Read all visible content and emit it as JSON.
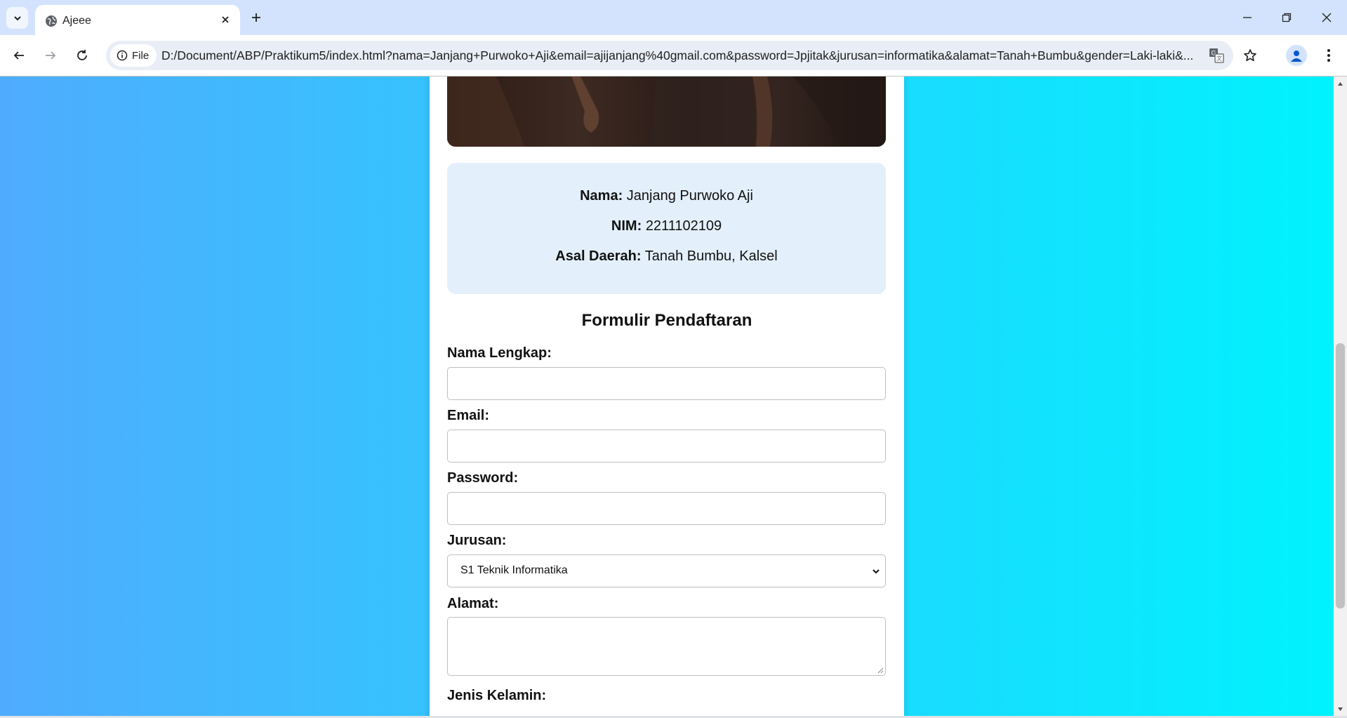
{
  "browser": {
    "tab_title": "Ajeee",
    "file_chip": "File",
    "url": "D:/Document/ABP/Praktikum5/index.html?nama=Janjang+Purwoko+Aji&email=ajijanjang%40gmail.com&password=Jpjitak&jurusan=informatika&alamat=Tanah+Bumbu&gender=Laki-laki&..."
  },
  "profile": {
    "nama_label": "Nama:",
    "nama_value": "Janjang Purwoko Aji",
    "nim_label": "NIM:",
    "nim_value": "2211102109",
    "asal_label": "Asal Daerah:",
    "asal_value": "Tanah Bumbu, Kalsel"
  },
  "form": {
    "title": "Formulir Pendaftaran",
    "nama_label": "Nama Lengkap:",
    "nama_value": "",
    "email_label": "Email:",
    "email_value": "",
    "password_label": "Password:",
    "password_value": "",
    "jurusan_label": "Jurusan:",
    "jurusan_selected": "S1 Teknik Informatika",
    "alamat_label": "Alamat:",
    "alamat_value": "",
    "gender_label": "Jenis Kelamin:"
  },
  "theme": {
    "gradient_start": "#4facfe",
    "gradient_end": "#00f2fe",
    "info_card_bg": "#e3f0fb"
  }
}
